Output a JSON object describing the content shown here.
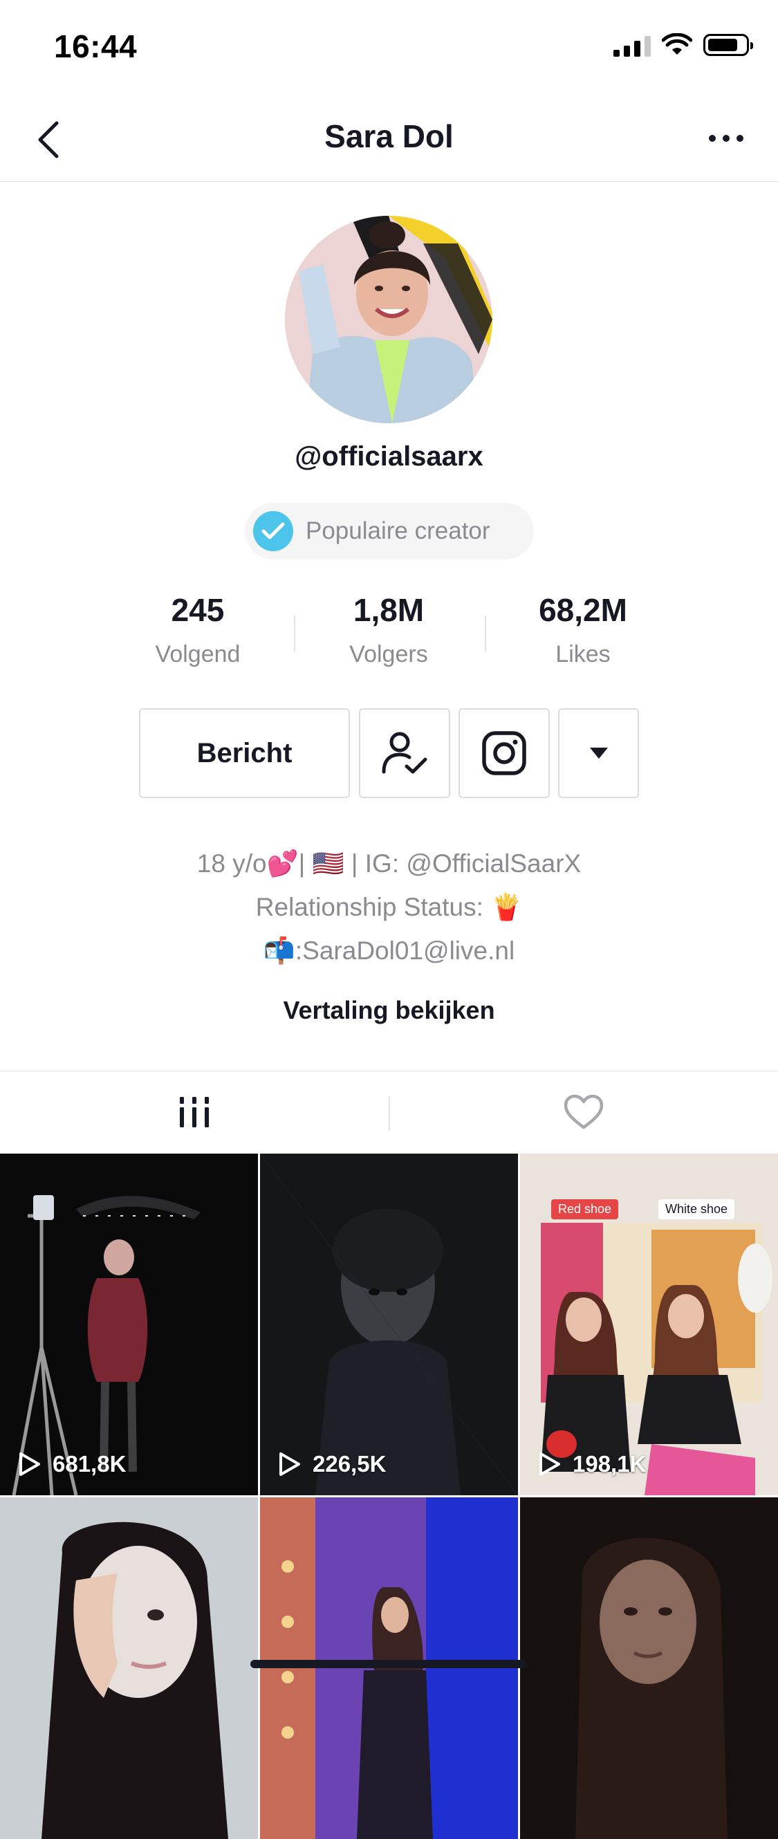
{
  "status_bar": {
    "time": "16:44"
  },
  "nav": {
    "title": "Sara Dol"
  },
  "profile": {
    "username": "@officialsaarx",
    "badge": "Populaire creator",
    "stats": [
      {
        "value": "245",
        "label": "Volgend"
      },
      {
        "value": "1,8M",
        "label": "Volgers"
      },
      {
        "value": "68,2M",
        "label": "Likes"
      }
    ],
    "message_button": "Bericht",
    "bio": [
      "18 y/o💕| 🇺🇸 | IG: @OfficialSaarX",
      "Relationship Status: 🍟",
      "📬:SaraDol01@live.nl"
    ],
    "translate": "Vertaling bekijken"
  },
  "videos": [
    {
      "views": "681,8K"
    },
    {
      "views": "226,5K"
    },
    {
      "views": "198,1K",
      "tag_left": "Red shoe",
      "tag_right": "White shoe"
    },
    {
      "views": ""
    },
    {
      "views": ""
    },
    {
      "views": ""
    }
  ],
  "colors": {
    "verified": "#4dc4ea",
    "text": "#161823",
    "secondary": "#8a8b91"
  }
}
